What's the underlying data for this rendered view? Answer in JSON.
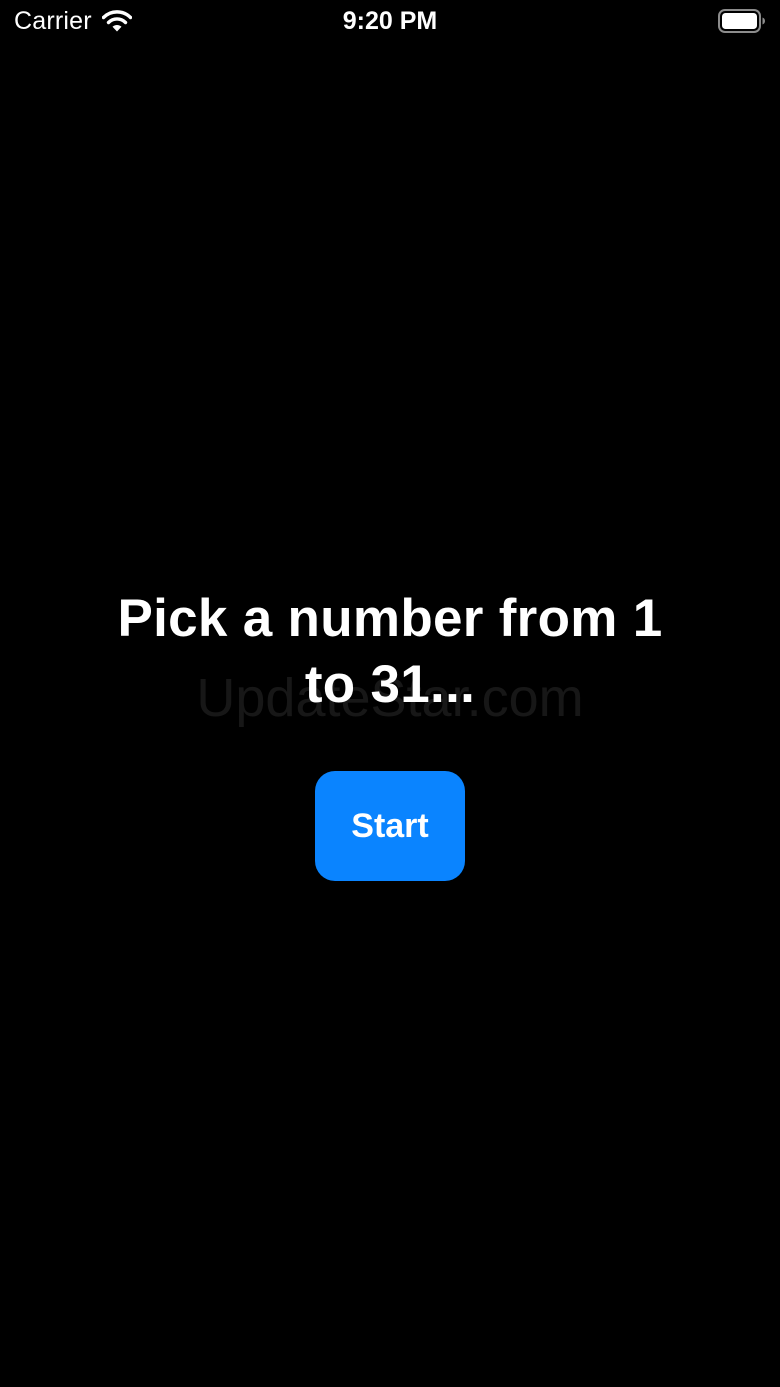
{
  "status_bar": {
    "carrier": "Carrier",
    "time": "9:20 PM",
    "wifi_icon": "wifi-icon",
    "battery_icon": "battery-full-icon"
  },
  "main": {
    "prompt": "Pick a number from 1 to 31...",
    "start_label": "Start"
  },
  "watermark": {
    "text": "UpdateStar.com"
  },
  "colors": {
    "background": "#000000",
    "text": "#ffffff",
    "accent": "#0a84ff"
  }
}
